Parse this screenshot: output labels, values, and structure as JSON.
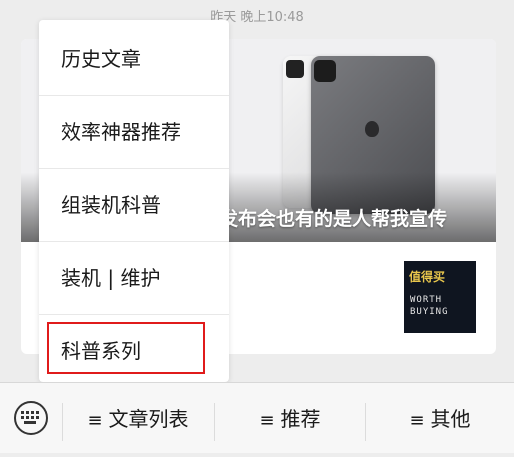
{
  "timestamp": "昨天 晚上10:48",
  "article": {
    "cover_title": "发布会也有的是人帮我宣传",
    "thumbnail_badge": "值得买",
    "thumbnail_text": "WORTH BUYING"
  },
  "popup_menu": {
    "items": [
      "历史文章",
      "效率神器推荐",
      "组装机科普",
      "装机 | 维护",
      "科普系列"
    ],
    "highlighted_index": 4,
    "highlight_color": "#e01b1b"
  },
  "bottom_menu": {
    "keyboard_icon": "keyboard-icon",
    "tabs": [
      {
        "icon": "≡",
        "label": "文章列表"
      },
      {
        "icon": "≡",
        "label": "推荐"
      },
      {
        "icon": "≡",
        "label": "其他"
      }
    ]
  }
}
